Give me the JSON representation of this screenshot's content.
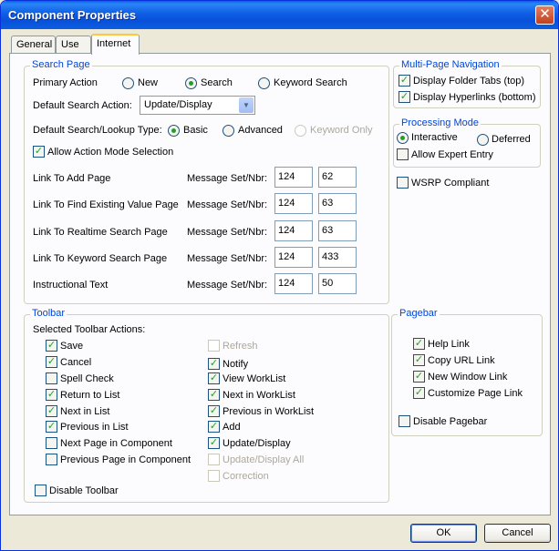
{
  "window": {
    "title": "Component Properties",
    "close_glyph": "✕"
  },
  "tabs": [
    "General",
    "Use",
    "Internet"
  ],
  "search_page": {
    "label": "Search Page",
    "primary_action_label": "Primary Action",
    "primary_options": [
      "New",
      "Search",
      "Keyword Search"
    ],
    "default_search_action_label": "Default Search Action:",
    "default_search_action_value": "Update/Display",
    "search_type_label": "Default Search/Lookup Type:",
    "search_type_options": [
      "Basic",
      "Advanced",
      "Keyword Only"
    ],
    "allow_action_mode": "Allow Action Mode Selection",
    "msg_label": "Message Set/Nbr:",
    "links": [
      {
        "label": "Link To Add Page",
        "set": "124",
        "nbr": "62"
      },
      {
        "label": "Link To Find Existing Value Page",
        "set": "124",
        "nbr": "63"
      },
      {
        "label": "Link To Realtime Search Page",
        "set": "124",
        "nbr": "63"
      },
      {
        "label": "Link To Keyword Search Page",
        "set": "124",
        "nbr": "433"
      },
      {
        "label": "Instructional Text",
        "set": "124",
        "nbr": "50"
      }
    ]
  },
  "multipage": {
    "label": "Multi-Page Navigation",
    "folder_tabs": "Display Folder Tabs (top)",
    "hyperlinks": "Display Hyperlinks (bottom)"
  },
  "processing": {
    "label": "Processing Mode",
    "interactive": "Interactive",
    "deferred": "Deferred",
    "expert": "Allow Expert Entry"
  },
  "wsrp": "WSRP Compliant",
  "toolbar": {
    "label": "Toolbar",
    "selected_label": "Selected Toolbar Actions:",
    "col1": [
      "Save",
      "Cancel",
      "Spell Check",
      "Return to List",
      "Next in List",
      "Previous in List",
      "Next Page in Component",
      "Previous Page in Component"
    ],
    "col2": [
      "Refresh",
      "Notify",
      "View WorkList",
      "Next in WorkList",
      "Previous in WorkList",
      "Add",
      "Update/Display",
      "Update/Display All",
      "Correction"
    ],
    "disable": "Disable Toolbar"
  },
  "pagebar": {
    "label": "Pagebar",
    "items": [
      "Help Link",
      "Copy URL Link",
      "New Window Link",
      "Customize Page Link"
    ],
    "disable": "Disable Pagebar"
  },
  "buttons": {
    "ok": "OK",
    "cancel": "Cancel"
  },
  "glyphs": {
    "check": "✓",
    "arrow": "▼"
  }
}
